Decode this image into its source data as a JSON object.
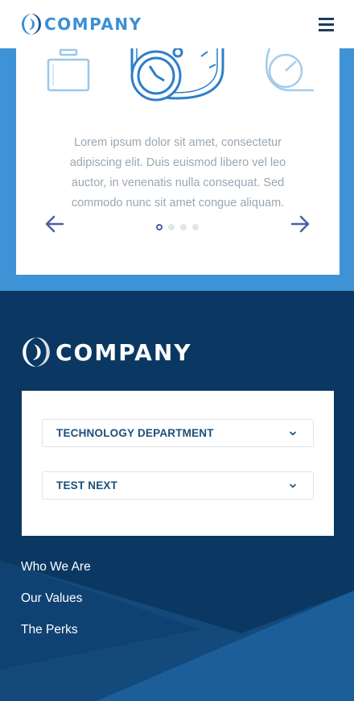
{
  "header": {
    "brand": "COMPANY",
    "brand_color": "#3b8fd4",
    "logo_icon": "company-logo-icon",
    "menu_icon": "hamburger-menu-icon"
  },
  "hero": {
    "background_color": "#3e92d6",
    "slide_icons": [
      "monitor-icon",
      "stopwatch-icon",
      "gauge-icon"
    ],
    "text": "Lorem ipsum dolor sit amet, consectetur adipiscing elit. Duis euismod libero vel leo auctor, in venenatis nulla consequat. Sed commodo nunc sit amet congue aliquam.",
    "prev_icon": "arrow-left-icon",
    "next_icon": "arrow-right-icon",
    "slide_count": 4,
    "active_slide": 1,
    "accent_color": "#4d5fa8"
  },
  "footer": {
    "brand": "COMPANY",
    "background_color": "#0b3862",
    "selects": [
      {
        "value": "TECHNOLOGY DEPARTMENT"
      },
      {
        "value": "TEST NEXT"
      }
    ],
    "links": [
      "Who We Are",
      "Our Values",
      "The Perks"
    ]
  }
}
